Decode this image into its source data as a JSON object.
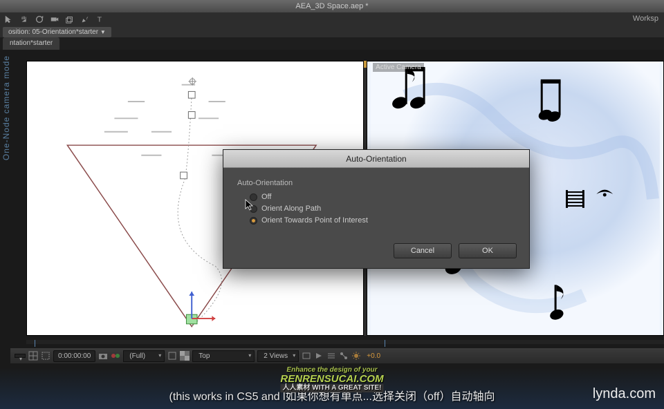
{
  "window": {
    "title": "AEA_3D Space.aep *"
  },
  "workspace_label": "Worksp",
  "side_text": "One-Node camera mode",
  "comp_tab": "osition: 05-Orientation*starter",
  "sub_tab": "ntation*starter",
  "views": {
    "left_label": "",
    "right_label": "Active Camera"
  },
  "dialog": {
    "title": "Auto-Orientation",
    "group": "Auto-Orientation",
    "options": {
      "off": "Off",
      "along": "Orient Along Path",
      "towards": "Orient Towards Point of Interest"
    },
    "cancel": "Cancel",
    "ok": "OK"
  },
  "bottom": {
    "timecode": "0:00:00:00",
    "res": "(Full)",
    "view_type": "Top",
    "view_count": "2 Views",
    "exposure": "+0.0"
  },
  "subtitle": "(this works in CS5 and l如果你想有单点...选择关闭（off）自动轴向",
  "lynda": "lynda.com",
  "watermark_top": "Enhance the design of your",
  "watermark_main": "RENRENSUCAI.COM",
  "watermark_sub": "人人素材 WITH A GREAT SITE!"
}
